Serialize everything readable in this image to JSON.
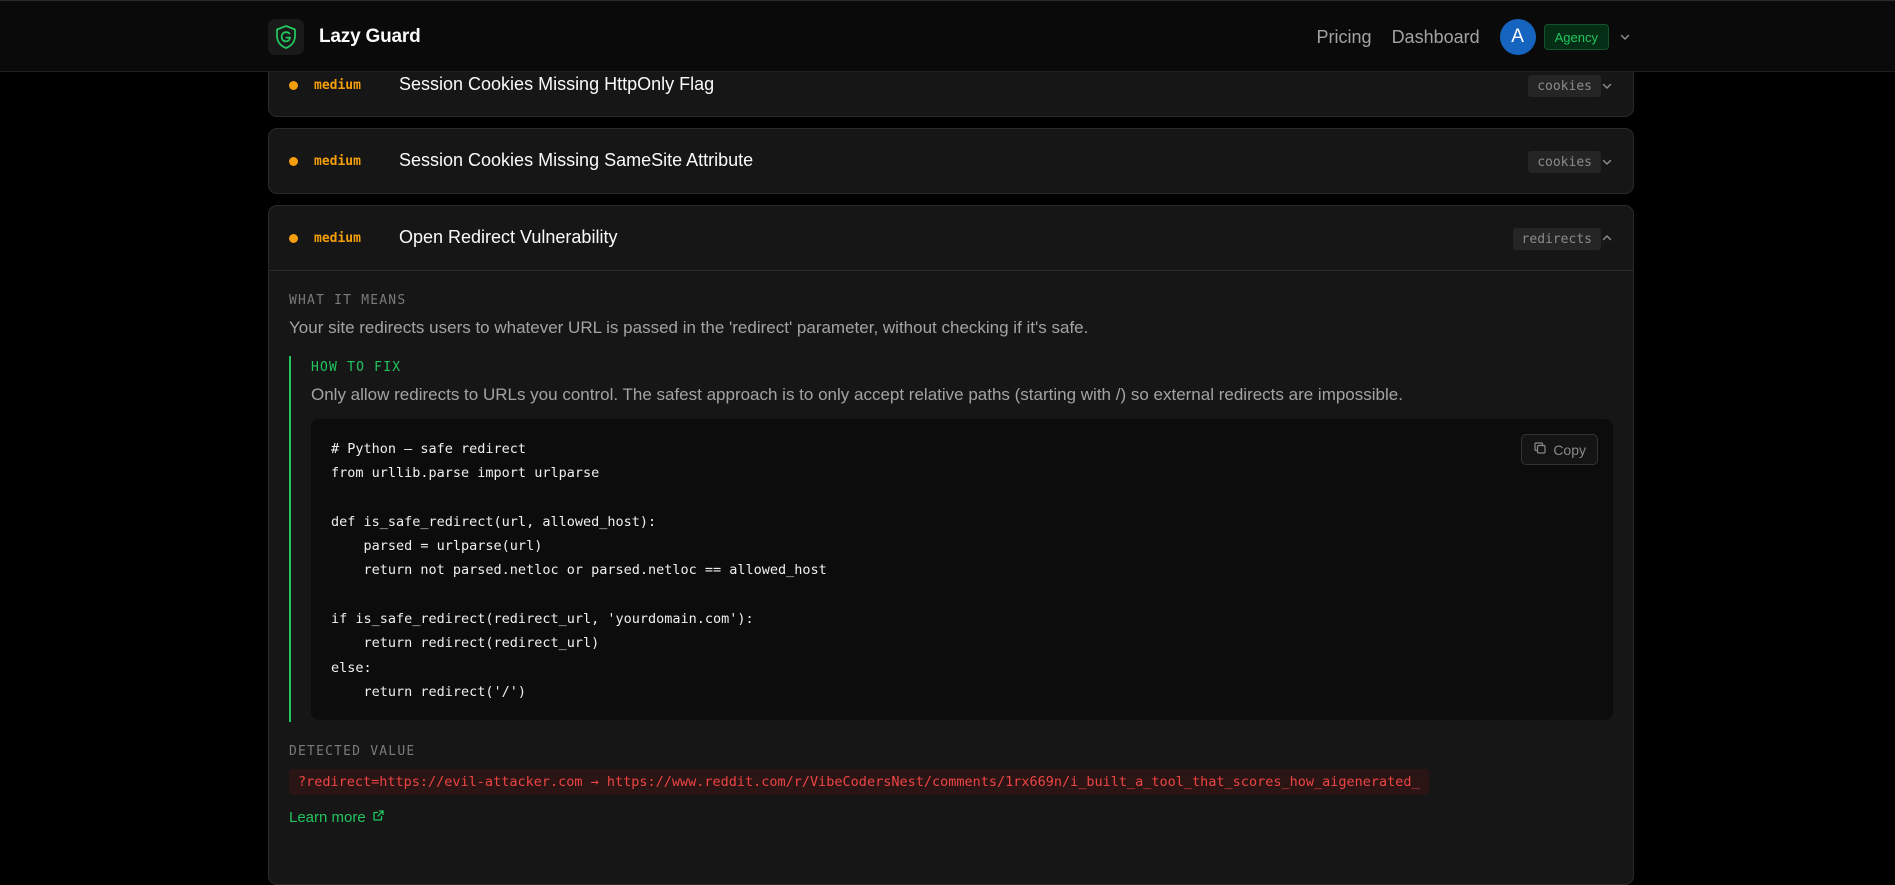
{
  "app": {
    "brand": "Lazy Guard",
    "nav": [
      {
        "label": "Pricing"
      },
      {
        "label": "Dashboard"
      }
    ],
    "user_initial": "A",
    "plan": "Agency",
    "colors": {
      "accent": "#22c55e",
      "severity_medium": "#f59e0b",
      "avatar": "#1565c0",
      "danger": "#ef4444"
    }
  },
  "issues": [
    {
      "severity": "medium",
      "title": "Session Cookies Missing HttpOnly Flag",
      "tag": "cookies",
      "expanded": false,
      "chevron_icon": "chevron-down-icon"
    },
    {
      "severity": "medium",
      "title": "Session Cookies Missing SameSite Attribute",
      "tag": "cookies",
      "expanded": false,
      "chevron_icon": "chevron-down-icon"
    },
    {
      "severity": "medium",
      "title": "Open Redirect Vulnerability",
      "tag": "redirects",
      "expanded": true,
      "chevron_icon": "chevron-up-icon",
      "what_it_means_label": "WHAT IT MEANS",
      "what_it_means": "Your site redirects users to whatever URL is passed in the 'redirect' parameter, without checking if it's safe.",
      "how_to_fix_label": "HOW TO FIX",
      "how_to_fix": "Only allow redirects to URLs you control. The safest approach is to only accept relative paths (starting with /) so external redirects are impossible.",
      "copy_label": "Copy",
      "code": [
        "# Python — safe redirect",
        "from urllib.parse import urlparse",
        "",
        "def is_safe_redirect(url, allowed_host):",
        "    parsed = urlparse(url)",
        "    return not parsed.netloc or parsed.netloc == allowed_host",
        "",
        "if is_safe_redirect(redirect_url, 'yourdomain.com'):",
        "    return redirect(redirect_url)",
        "else:",
        "    return redirect('/')"
      ],
      "detected_value_label": "DETECTED VALUE",
      "detected_value": "?redirect=https://evil-attacker.com → https://www.reddit.com/r/VibeCodersNest/comments/1rx669n/i_built_a_tool_that_scores_how_aigenerated_",
      "learn_more": "Learn more"
    }
  ]
}
